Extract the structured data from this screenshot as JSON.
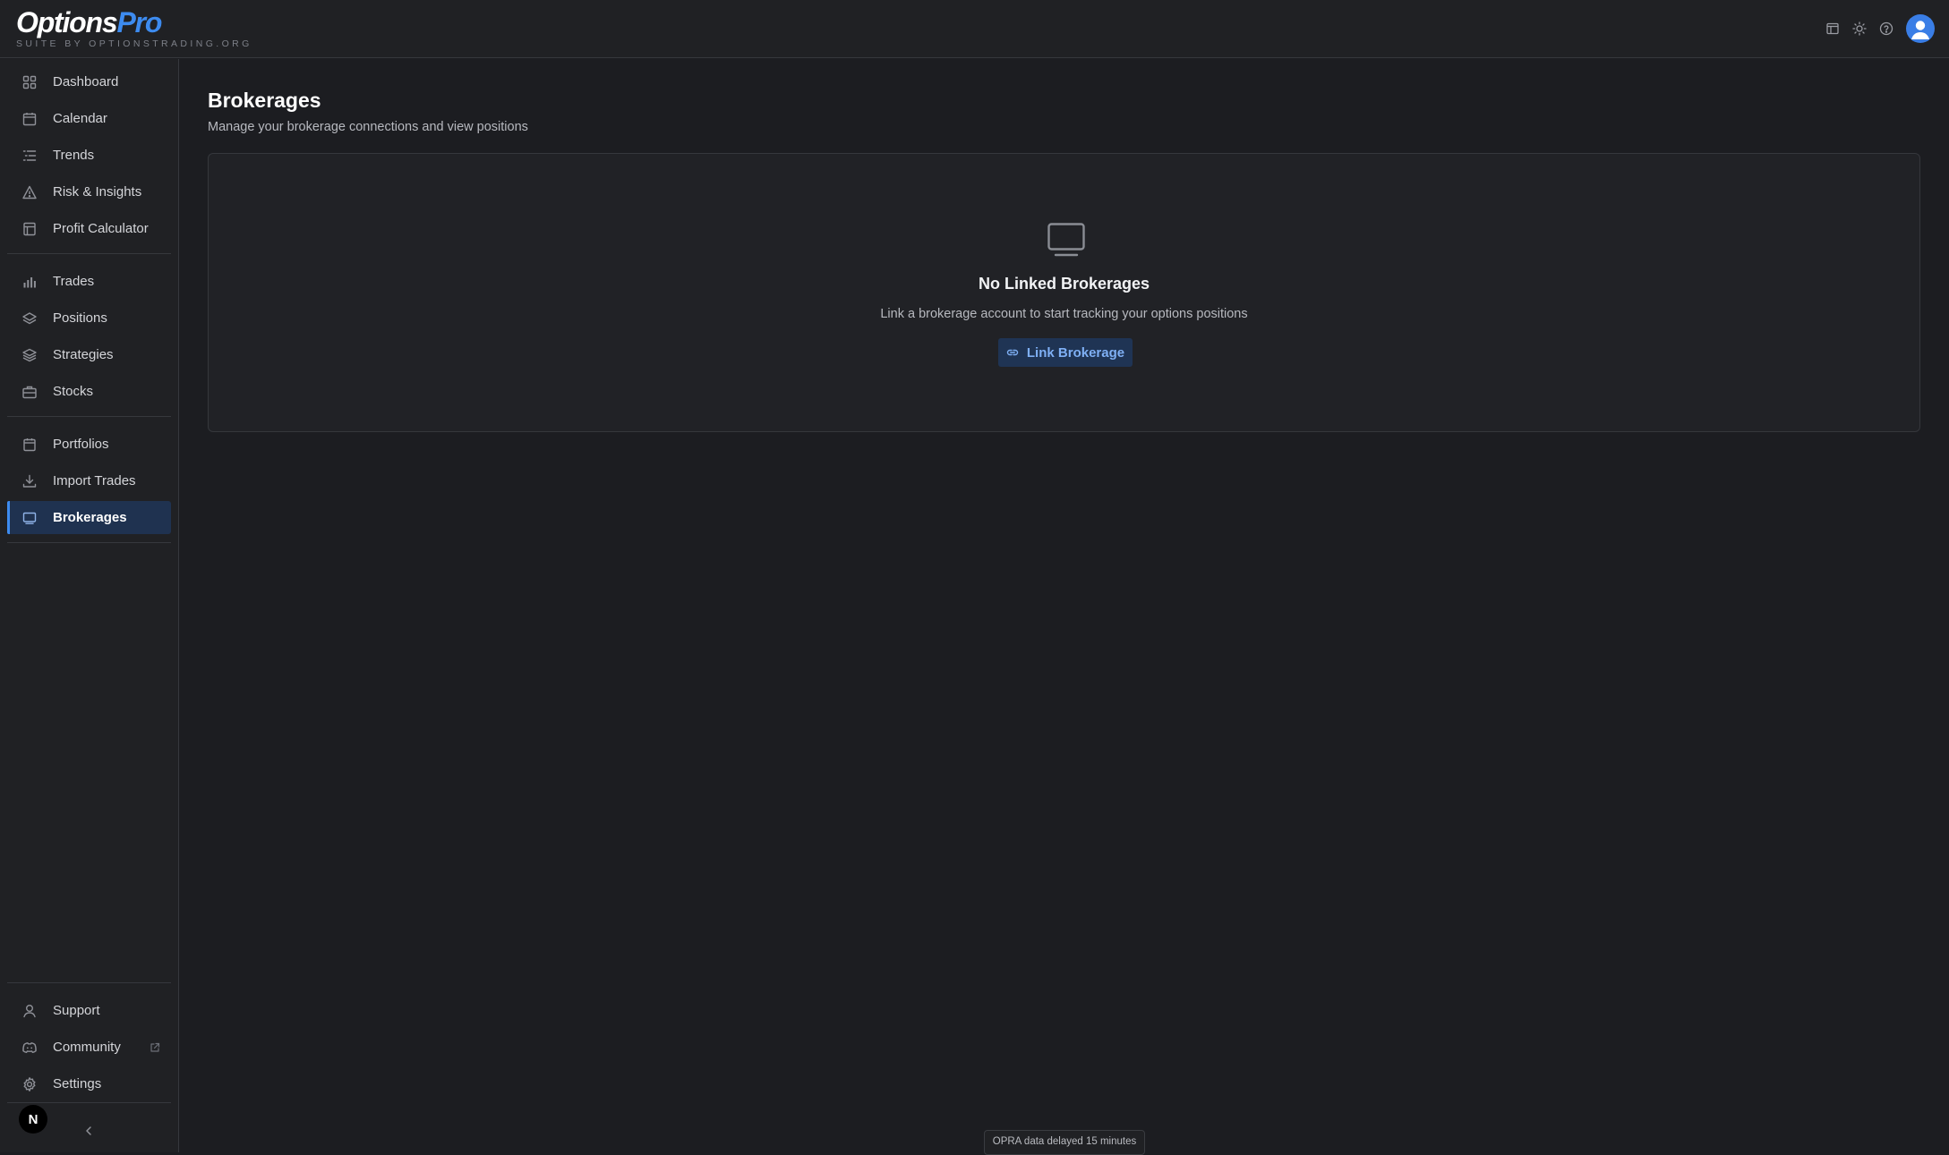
{
  "brand": {
    "name_main": "Options",
    "name_accent": "Pro",
    "tagline": "SUITE BY OPTIONSTRADING.ORG"
  },
  "topbar": {
    "icons": [
      "calendar-panel-icon",
      "sun-icon",
      "help-icon",
      "user-avatar-icon"
    ]
  },
  "sidebar": {
    "groups": [
      [
        {
          "label": "Dashboard",
          "icon": "grid-icon"
        },
        {
          "label": "Calendar",
          "icon": "calendar-icon"
        },
        {
          "label": "Trends",
          "icon": "list-icon"
        },
        {
          "label": "Risk & Insights",
          "icon": "warning-triangle-icon"
        },
        {
          "label": "Profit Calculator",
          "icon": "calculator-icon"
        }
      ],
      [
        {
          "label": "Trades",
          "icon": "bar-chart-icon"
        },
        {
          "label": "Positions",
          "icon": "layers-icon"
        },
        {
          "label": "Strategies",
          "icon": "stack-icon"
        },
        {
          "label": "Stocks",
          "icon": "briefcase-icon"
        }
      ],
      [
        {
          "label": "Portfolios",
          "icon": "folder-icon"
        },
        {
          "label": "Import Trades",
          "icon": "download-icon"
        },
        {
          "label": "Brokerages",
          "icon": "monitor-icon",
          "active": true
        }
      ]
    ],
    "bottom": [
      {
        "label": "Support",
        "icon": "person-icon"
      },
      {
        "label": "Community",
        "icon": "discord-icon",
        "external": true
      },
      {
        "label": "Settings",
        "icon": "gear-icon"
      }
    ],
    "footer_badge": "N",
    "collapse_icon": "chevron-left-icon"
  },
  "main": {
    "title": "Brokerages",
    "subtitle": "Manage your brokerage connections and view positions",
    "empty_state": {
      "icon": "monitor-icon",
      "title": "No Linked Brokerages",
      "description": "Link a brokerage account to start tracking your options positions",
      "button_label": "Link Brokerage",
      "button_icon": "link-icon"
    }
  },
  "status_bar": {
    "text": "OPRA data delayed 15 minutes"
  },
  "colors": {
    "accent": "#3d8bef",
    "background": "#1c1d21",
    "panel": "#202124",
    "active_nav": "#1f3250"
  }
}
